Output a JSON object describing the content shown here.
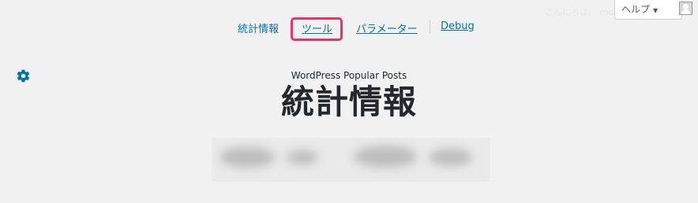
{
  "header": {
    "help_label": "ヘルプ",
    "help_arrow": "▼",
    "faded_text": "こんにちは、 momo さん"
  },
  "tabs": [
    {
      "label": "統計情報"
    },
    {
      "label": "ツール"
    },
    {
      "label": "パラメーター"
    },
    {
      "label": "Debug"
    }
  ],
  "settings": {
    "icon": "gear-icon"
  },
  "page": {
    "plugin_name": "WordPress Popular Posts",
    "title": "統計情報"
  },
  "colors": {
    "link": "#0073aa",
    "highlight": "#e8336b",
    "background": "#f1f1f1"
  }
}
